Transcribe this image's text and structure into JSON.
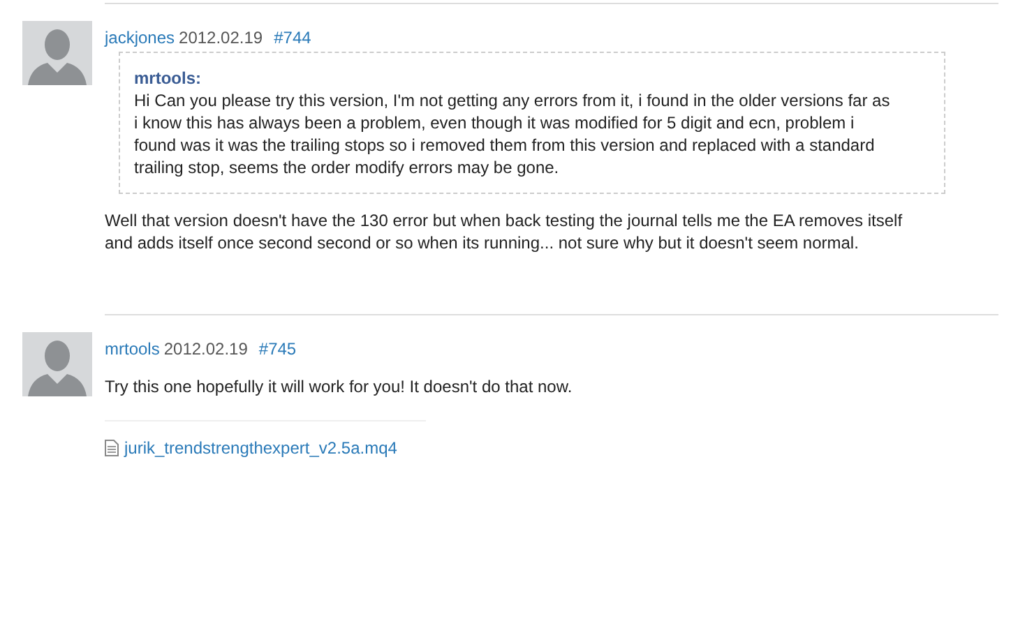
{
  "posts": [
    {
      "author": "jackjones",
      "date": "2012.02.19",
      "number": "#744",
      "quote": {
        "author": "mrtools:",
        "text": "Hi Can you please try this version, I'm not getting any errors from it, i found in the older versions far as i know this has always been a problem, even though it was modified for 5 digit and ecn, problem i found was it was the trailing stops so i removed them from this version and replaced with a standard trailing stop, seems the order modify errors may be gone."
      },
      "text": "Well that version doesn't have the 130 error but when back testing the journal tells me the EA removes itself and adds itself once second second or so when its running... not sure why but it doesn't seem normal."
    },
    {
      "author": "mrtools",
      "date": "2012.02.19",
      "number": "#745",
      "text": "Try this one hopefully it will work for you! It doesn't do that now.",
      "attachments": [
        "jurik_trendstrengthexpert_v2.5a.mq4"
      ]
    }
  ]
}
